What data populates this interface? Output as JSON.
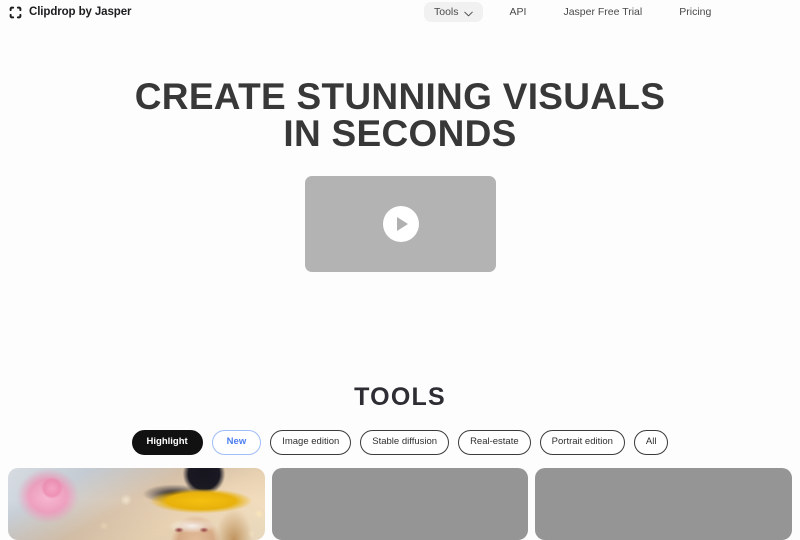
{
  "header": {
    "brand": {
      "name": "Clipdrop by Jasper",
      "icon": "crop-frame-icon"
    },
    "nav": [
      {
        "label": "Tools",
        "has_dropdown": true,
        "highlighted": true,
        "icon": "chevron-down-icon"
      },
      {
        "label": "API",
        "has_dropdown": false,
        "highlighted": false
      },
      {
        "label": "Jasper Free Trial",
        "has_dropdown": false,
        "highlighted": false
      },
      {
        "label": "Pricing",
        "has_dropdown": false,
        "highlighted": false
      }
    ]
  },
  "hero": {
    "title_line_1": "CREATE STUNNING VISUALS",
    "title_line_2": "IN SECONDS",
    "video": {
      "play_icon": "play-triangle-icon",
      "placeholder_color": "#b3b3b3"
    }
  },
  "tools": {
    "heading": "TOOLS",
    "filters": [
      {
        "label": "Highlight",
        "state": "active"
      },
      {
        "label": "New",
        "state": "accent"
      },
      {
        "label": "Image edition",
        "state": "default"
      },
      {
        "label": "Stable diffusion",
        "state": "default"
      },
      {
        "label": "Real-estate",
        "state": "default"
      },
      {
        "label": "Portrait edition",
        "state": "default"
      },
      {
        "label": "All",
        "state": "default"
      }
    ],
    "cards": [
      {
        "kind": "photo",
        "alt": "Woman wearing yellow and black wizard hat with red sunglasses, pink star balloon"
      },
      {
        "kind": "placeholder",
        "alt": ""
      },
      {
        "kind": "placeholder",
        "alt": ""
      }
    ]
  },
  "colors": {
    "page_background": "#fdfdfd",
    "text": "#333333",
    "accent_blue": "#4b7ef1",
    "active_pill": "#111111",
    "placeholder_gray": "#959595",
    "nav_pill_background": "#f1f1f1"
  }
}
